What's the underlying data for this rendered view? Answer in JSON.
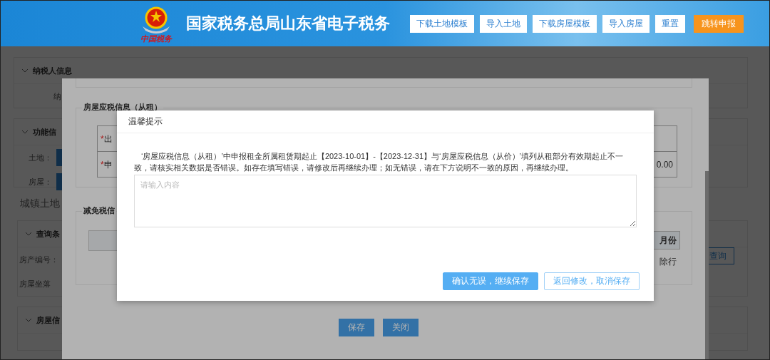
{
  "header": {
    "logo_caption": "中国税务",
    "title": "国家税务总局山东省电子税务",
    "buttons": [
      {
        "label": "下载土地模板",
        "kind": "plain"
      },
      {
        "label": "导入土地",
        "kind": "plain"
      },
      {
        "label": "下载房屋模板",
        "kind": "plain"
      },
      {
        "label": "导入房屋",
        "kind": "plain"
      },
      {
        "label": "重置",
        "kind": "plain"
      },
      {
        "label": "跳转申报",
        "kind": "primary"
      }
    ]
  },
  "page": {
    "taxpayer_section": {
      "title": "纳税人信息",
      "field_label": "纳"
    },
    "function_section": {
      "title": "功能信",
      "rows": [
        {
          "label": "土地："
        },
        {
          "label": "房屋："
        }
      ]
    },
    "land_heading": "城镇土地",
    "query_section": {
      "title": "查询条",
      "fields": [
        {
          "label": "房产编号："
        },
        {
          "label": "房屋坐落"
        }
      ],
      "button": "查询"
    },
    "house_section": {
      "title": "房屋信"
    }
  },
  "modal": {
    "rent_section": {
      "title": "房屋应税信息（从租）",
      "rows": [
        {
          "mark": "*",
          "label": "出"
        },
        {
          "mark": "*",
          "label": "申",
          "value": "0.00"
        }
      ]
    },
    "relief_section": {
      "title": "减免税信",
      "month_button": "月份",
      "delete_link": "除行"
    },
    "buttons": [
      {
        "label": "保存"
      },
      {
        "label": "关闭"
      }
    ]
  },
  "dialog": {
    "title": "温馨提示",
    "message": "‘房屋应税信息（从租）’中申报租金所属租赁期起止【2023-10-01】-【2023-12-31】与‘房屋应税信息（从价）’填列从租部分有效期起止不一致，请核实相关数据是否错误。如存在填写错误，请修改后再继续办理；如无错误，请在下方说明不一致的原因，再继续办理。",
    "placeholder": "请输入内容",
    "buttons": [
      {
        "label": "确认无误，继续保存",
        "kind": "primary"
      },
      {
        "label": "返回修改，取消保存",
        "kind": "outline"
      }
    ]
  }
}
